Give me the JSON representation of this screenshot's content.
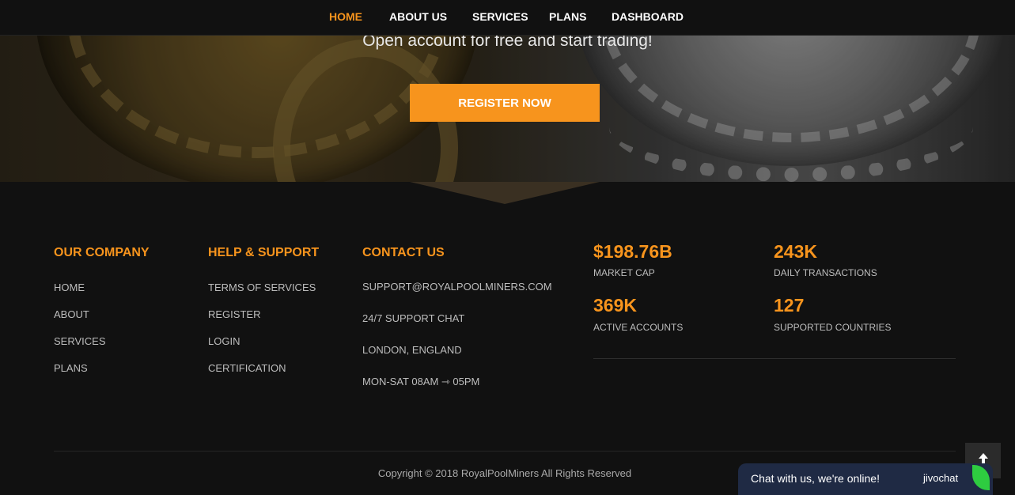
{
  "nav": {
    "items": [
      {
        "label": "HOME",
        "active": true
      },
      {
        "label": "ABOUT US",
        "active": false
      },
      {
        "label": "SERVICES",
        "active": false
      },
      {
        "label": "PLANS",
        "active": false
      },
      {
        "label": "DASHBOARD",
        "active": false
      }
    ]
  },
  "hero": {
    "tagline": "Open account for free and start trading!",
    "register_label": "REGISTER NOW"
  },
  "footer": {
    "company": {
      "title": "OUR COMPANY",
      "links": [
        "HOME",
        "ABOUT",
        "SERVICES",
        "PLANS"
      ]
    },
    "help": {
      "title": "HELP & SUPPORT",
      "links": [
        "TERMS OF SERVICES",
        "REGISTER",
        "LOGIN",
        "CERTIFICATION"
      ]
    },
    "contact": {
      "title": "CONTACT US",
      "items": [
        "SUPPORT@ROYALPOOLMINERS.COM",
        "24/7 SUPPORT CHAT",
        "LONDON, ENGLAND",
        "MON-SAT 08AM ⇾ 05PM"
      ]
    },
    "stats": [
      {
        "value": "$198.76B",
        "label": "MARKET CAP"
      },
      {
        "value": "243K",
        "label": "DAILY TRANSACTIONS"
      },
      {
        "value": "369K",
        "label": "ACTIVE ACCOUNTS"
      },
      {
        "value": "127",
        "label": "SUPPORTED COUNTRIES"
      }
    ],
    "copyright": "Copyright © 2018 RoyalPoolMiners All Rights Reserved"
  },
  "chat": {
    "text": "Chat with us, we're online!",
    "brand": "jivochat"
  },
  "colors": {
    "accent": "#f7941d",
    "background": "#111111"
  },
  "icons": {
    "scroll_top": "arrow-up-icon",
    "chat_brand": "jivochat-leaf-icon"
  }
}
